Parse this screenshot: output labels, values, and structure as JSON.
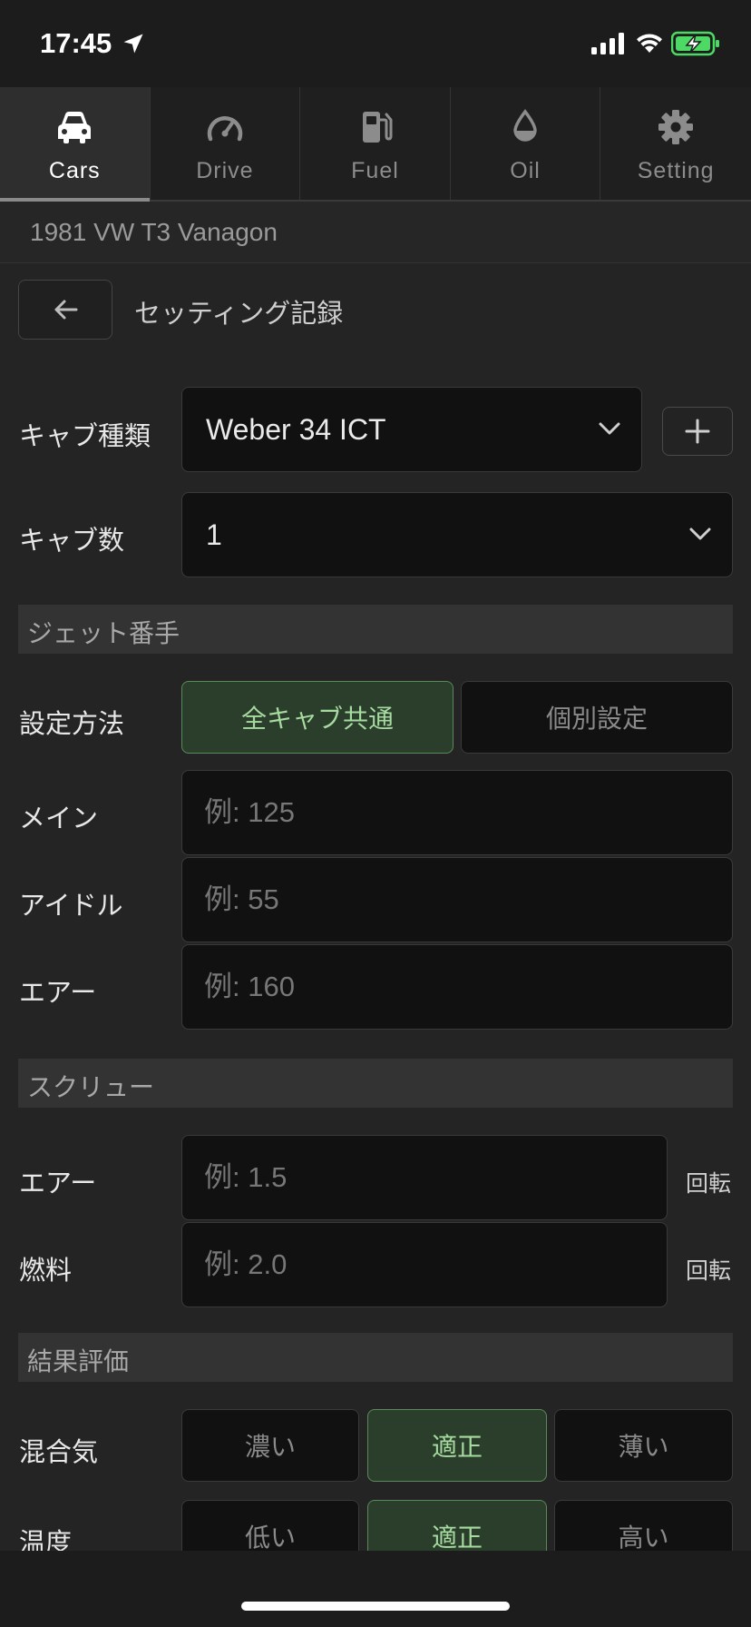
{
  "status_bar": {
    "time": "17:45"
  },
  "tabs": [
    {
      "label": "Cars",
      "icon": "car-icon",
      "active": true
    },
    {
      "label": "Drive",
      "icon": "speedometer-icon",
      "active": false
    },
    {
      "label": "Fuel",
      "icon": "fuel-pump-icon",
      "active": false
    },
    {
      "label": "Oil",
      "icon": "oil-drop-icon",
      "active": false
    },
    {
      "label": "Setting",
      "icon": "gear-icon",
      "active": false
    }
  ],
  "vehicle": {
    "name": "1981 VW T3 Vanagon"
  },
  "page": {
    "title": "セッティング記録"
  },
  "carb_type": {
    "label": "キャブ種類",
    "value": "Weber 34 ICT"
  },
  "carb_count": {
    "label": "キャブ数",
    "value": "1"
  },
  "jet_section": {
    "title": "ジェット番手",
    "method_label": "設定方法",
    "method_options": [
      "全キャブ共通",
      "個別設定"
    ],
    "method_selected": "全キャブ共通",
    "main": {
      "label": "メイン",
      "placeholder": "例: 125"
    },
    "idle": {
      "label": "アイドル",
      "placeholder": "例: 55"
    },
    "air": {
      "label": "エアー",
      "placeholder": "例: 160"
    }
  },
  "screw_section": {
    "title": "スクリュー",
    "air": {
      "label": "エアー",
      "placeholder": "例: 1.5",
      "unit": "回転"
    },
    "fuel": {
      "label": "燃料",
      "placeholder": "例: 2.0",
      "unit": "回転"
    }
  },
  "result_section": {
    "title": "結果評価",
    "mixture": {
      "label": "混合気",
      "options": [
        "濃い",
        "適正",
        "薄い"
      ],
      "selected": "適正"
    },
    "temperature": {
      "label": "温度",
      "options": [
        "低い",
        "適正",
        "高い"
      ],
      "selected": "適正"
    }
  },
  "colors": {
    "background": "#242424",
    "selected_green": "#2b3e2b",
    "selected_text": "#a6dba0",
    "battery_green": "#4cd964"
  }
}
